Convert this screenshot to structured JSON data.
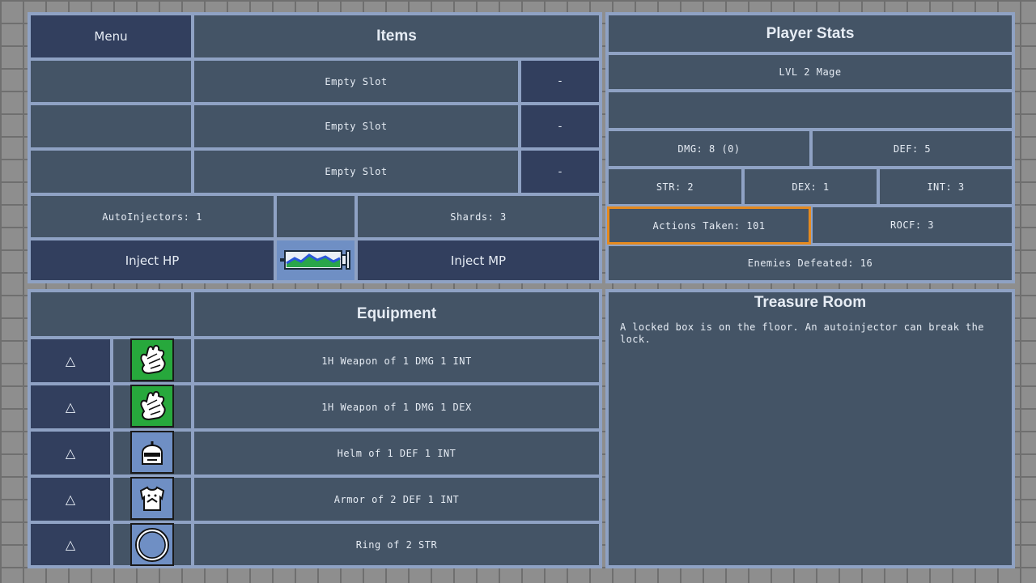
{
  "items_panel": {
    "menu_label": "Menu",
    "title": "Items",
    "slots": [
      {
        "name": "Empty Slot",
        "action": "-"
      },
      {
        "name": "Empty Slot",
        "action": "-"
      },
      {
        "name": "Empty Slot",
        "action": "-"
      }
    ],
    "autoinjectors": "AutoInjectors: 1",
    "shards": "Shards: 3",
    "inject_hp": "Inject HP",
    "inject_mp": "Inject MP",
    "injector_icon": "syringe-icon"
  },
  "stats_panel": {
    "title": "Player Stats",
    "level": "LVL 2 Mage",
    "dmg": "DMG: 8 (0)",
    "def": "DEF: 5",
    "str": "STR: 2",
    "dex": "DEX: 1",
    "int": "INT: 3",
    "actions": "Actions Taken: 101",
    "rocf": "ROCF: 3",
    "enemies": "Enemies Defeated: 16"
  },
  "equipment_panel": {
    "title": "Equipment",
    "items": [
      {
        "arrow": "△",
        "icon": "glove-icon",
        "name": "1H Weapon of 1 DMG 1 INT"
      },
      {
        "arrow": "△",
        "icon": "glove-icon",
        "name": "1H Weapon of 1 DMG 1 DEX"
      },
      {
        "arrow": "△",
        "icon": "helm-icon",
        "name": "Helm of 1 DEF 1 INT"
      },
      {
        "arrow": "△",
        "icon": "armor-icon",
        "name": "Armor of 2 DEF 1 INT"
      },
      {
        "arrow": "△",
        "icon": "ring-icon",
        "name": "Ring of 2 STR"
      }
    ]
  },
  "room_panel": {
    "title": "Treasure Room",
    "description": "A locked box is on the floor. An autoinjector can break the lock."
  },
  "colors": {
    "cell": "#445466",
    "button": "#323f5e",
    "border": "#8fa2c4",
    "highlight": "#e58a1f",
    "icon_green": "#27a83c",
    "icon_blue": "#6f8fc4"
  }
}
